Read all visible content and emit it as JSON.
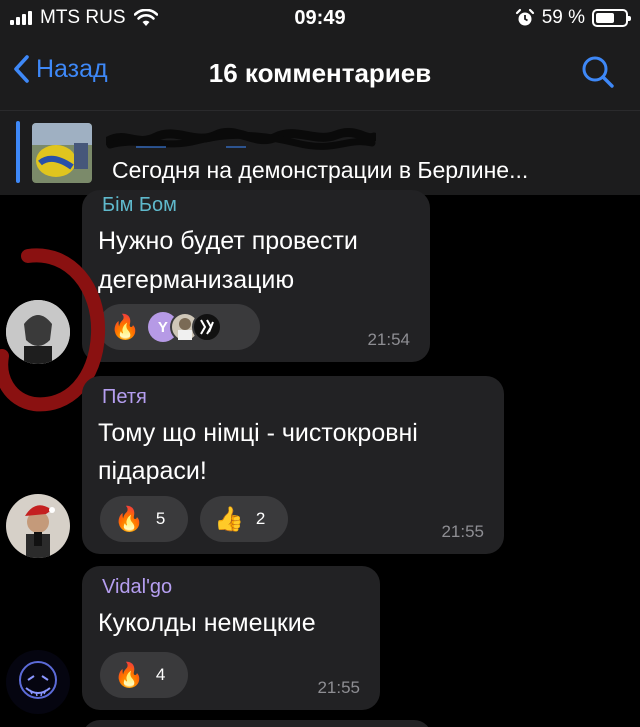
{
  "status_bar": {
    "carrier": "MTS RUS",
    "time": "09:49",
    "battery": "59 %"
  },
  "nav": {
    "back_label": "Назад",
    "title": "16 комментариев"
  },
  "pinned": {
    "text": "Сегодня на демонстрации в Берлине..."
  },
  "comments": [
    {
      "author": "Бім Бом",
      "text_line1": "Нужно будет провести",
      "text_line2": "дегерманизацию",
      "reaction_avatar_letter": "Y",
      "time": "21:54"
    },
    {
      "author": "Петя",
      "text_line1": "Тому що німці - чистокровні",
      "text_line2": "підараси!",
      "reactions": [
        {
          "emoji": "🔥",
          "count": "5"
        },
        {
          "emoji": "👍",
          "count": "2"
        }
      ],
      "time": "21:55"
    },
    {
      "author": "Vidal'go",
      "text_line1": "Куколды немецкие",
      "reactions": [
        {
          "emoji": "🔥",
          "count": "4"
        }
      ],
      "time": "21:55"
    }
  ],
  "colors": {
    "accent": "#3e88f7",
    "author1": "#5fb9cc",
    "author2": "#b59ef0",
    "author3": "#b59ef0",
    "bubble": "#222224",
    "circle_annotation": "#8a1111"
  }
}
